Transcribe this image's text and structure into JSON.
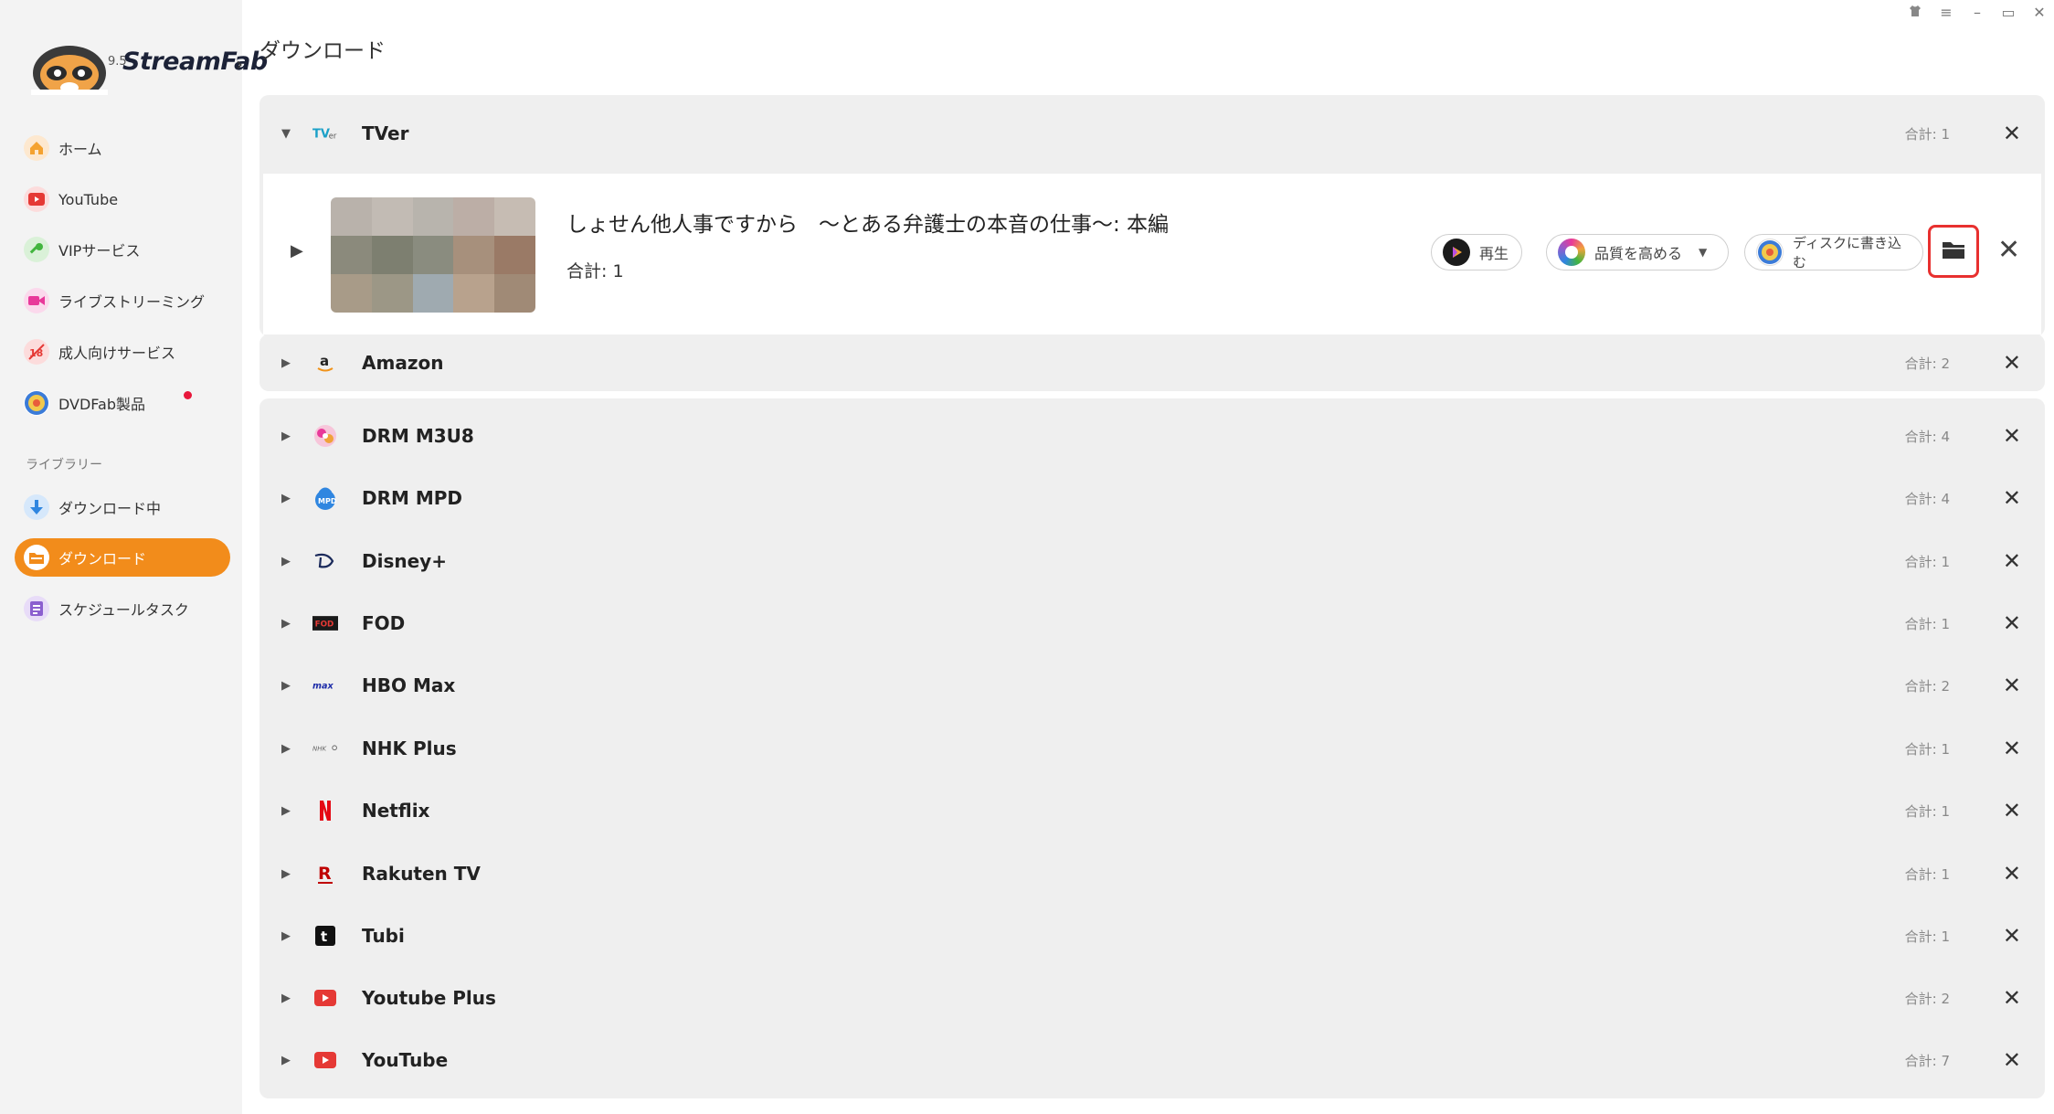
{
  "app": {
    "logo_name": "StreamFab",
    "version_fragment": "9.5"
  },
  "window_controls": [
    "shirt-icon",
    "menu-icon",
    "minimize-icon",
    "maximize-icon",
    "close-icon"
  ],
  "sidebar": {
    "items": [
      {
        "label": "ホーム",
        "icon": "home-icon",
        "color": "#f4a230"
      },
      {
        "label": "YouTube",
        "icon": "youtube-icon",
        "color": "#e53935"
      },
      {
        "label": "VIPサービス",
        "icon": "key-icon",
        "color": "#43b53f"
      },
      {
        "label": "ライブストリーミング",
        "icon": "video-camera-icon",
        "color": "#e8399a"
      },
      {
        "label": "成人向けサービス",
        "icon": "adult-icon",
        "color": "#e53935"
      },
      {
        "label": "DVDFab製品",
        "icon": "dvdfab-icon",
        "color": "#3b7bd8"
      }
    ],
    "library_label": "ライブラリー",
    "library_items": [
      {
        "label": "ダウンロード中",
        "icon": "download-arrow-icon",
        "color": "#2f86e0",
        "active": false
      },
      {
        "label": "ダウンロード",
        "icon": "folder-icon",
        "color": "#ffffff",
        "active": true
      },
      {
        "label": "スケジュールタスク",
        "icon": "task-list-icon",
        "color": "#8b5fcf",
        "active": false
      }
    ]
  },
  "main": {
    "page_title": "ダウンロード",
    "count_prefix": "合計",
    "expanded_group": {
      "name": "TVer",
      "count": "合計: 1",
      "item": {
        "title": "しょせん他人事ですから　～とある弁護士の本音の仕事～: 本編",
        "count": "合計: 1",
        "actions": {
          "play": "再生",
          "enhance": "品質を高める",
          "burn": "ディスクに書き込む"
        }
      }
    },
    "groups": [
      {
        "name": "Amazon",
        "count": "合計: 2",
        "icon": "amazon-icon"
      },
      {
        "name": "DRM M3U8",
        "count": "合計: 4",
        "icon": "drm-m3u8-icon"
      },
      {
        "name": "DRM MPD",
        "count": "合計: 4",
        "icon": "drm-mpd-icon"
      },
      {
        "name": "Disney+",
        "count": "合計: 1",
        "icon": "disney-plus-icon"
      },
      {
        "name": "FOD",
        "count": "合計: 1",
        "icon": "fod-icon"
      },
      {
        "name": "HBO Max",
        "count": "合計: 2",
        "icon": "hbo-max-icon"
      },
      {
        "name": "NHK Plus",
        "count": "合計: 1",
        "icon": "nhk-plus-icon"
      },
      {
        "name": "Netflix",
        "count": "合計: 1",
        "icon": "netflix-icon"
      },
      {
        "name": "Rakuten TV",
        "count": "合計: 1",
        "icon": "rakuten-tv-icon"
      },
      {
        "name": "Tubi",
        "count": "合計: 1",
        "icon": "tubi-icon"
      },
      {
        "name": "Youtube Plus",
        "count": "合計: 2",
        "icon": "youtube-plus-icon"
      },
      {
        "name": "YouTube",
        "count": "合計: 7",
        "icon": "youtube-icon"
      }
    ]
  },
  "colors": {
    "accent": "#f28c1b",
    "highlight_border": "#e8302f",
    "group_background": "#efefef",
    "sidebar_background": "#f3f3f3"
  }
}
